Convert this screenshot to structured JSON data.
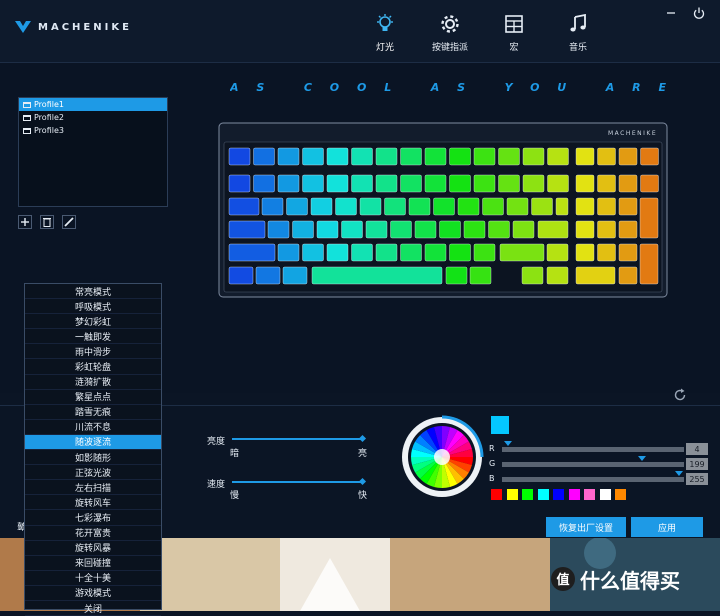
{
  "brand": "MACHENIKE",
  "nav": [
    {
      "label": "灯光",
      "icon": "lightbulb-icon"
    },
    {
      "label": "按键指派",
      "icon": "gear-icon"
    },
    {
      "label": "宏",
      "icon": "grid-icon"
    },
    {
      "label": "音乐",
      "icon": "music-note-icon"
    }
  ],
  "slogan": "AS COOL AS YOU ARE",
  "profiles": [
    "Profile1",
    "Profile2",
    "Profile3"
  ],
  "keyboard_brand": "MACHENIKE",
  "modes": [
    "常亮模式",
    "呼吸模式",
    "梦幻彩虹",
    "一触即发",
    "雨中滑步",
    "彩虹轮盘",
    "涟漪扩散",
    "繁星点点",
    "踏雪无痕",
    "川流不息",
    "随波逐流",
    "如影随形",
    "正弦光波",
    "左右扫描",
    "旋转风车",
    "七彩瀑布",
    "花开富贵",
    "旋转风暴",
    "来回碰撞",
    "十全十美",
    "游戏模式",
    "关闭"
  ],
  "selected_mode": "随波逐流",
  "brightness": {
    "label": "亮度",
    "min_label": "暗",
    "max_label": "亮",
    "level": 1.0
  },
  "speed": {
    "label": "速度",
    "min_label": "慢",
    "max_label": "快",
    "level": 1.0
  },
  "rgb": {
    "r": {
      "label": "R",
      "value": "4"
    },
    "g": {
      "label": "G",
      "value": "199"
    },
    "b": {
      "label": "B",
      "value": "255"
    }
  },
  "current_color": "#04C7FF",
  "preset_colors": [
    "#ff0000",
    "#ffff00",
    "#00ff00",
    "#00ffff",
    "#0000ff",
    "#ff00ff",
    "#ff66cc",
    "#ffffff",
    "#ff8800"
  ],
  "side_label": "鼙",
  "buttons": {
    "reset": "恢复出厂设置",
    "apply": "应用"
  }
}
